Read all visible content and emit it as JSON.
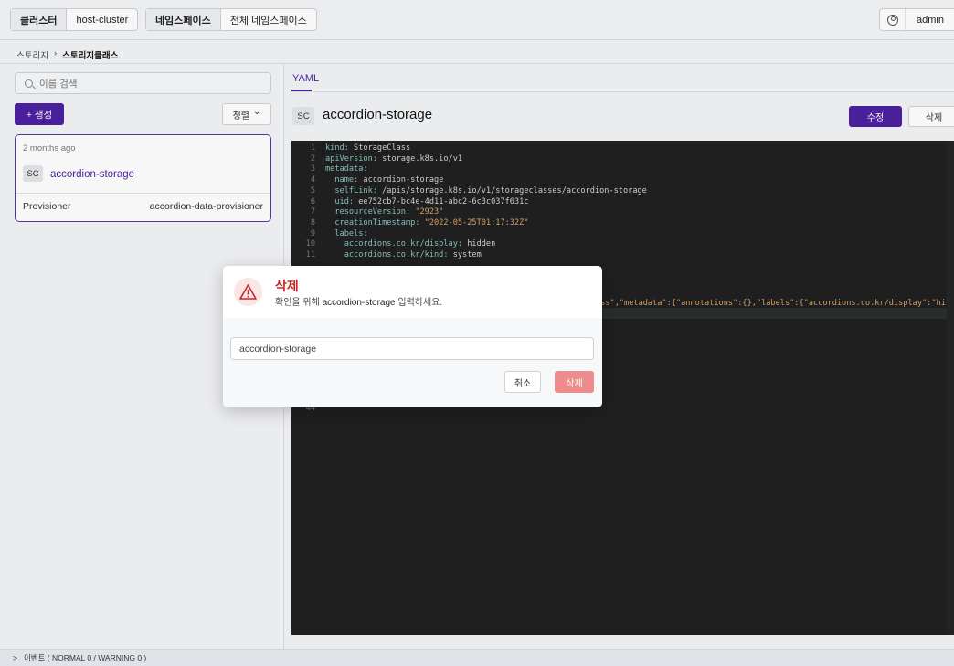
{
  "topbar": {
    "cluster_label": "클러스터",
    "cluster_value": "host-cluster",
    "namespace_label": "네임스페이스",
    "namespace_value": "전체 네임스페이스",
    "user_name": "admin",
    "user_icon": "user-circle-icon"
  },
  "breadcrumb": {
    "parent": "스토리지",
    "separator": "›",
    "current": "스토리지클래스"
  },
  "left": {
    "search_placeholder": "이름 검색",
    "create_label": "+ 생성",
    "sort_label": "정렬",
    "sort_icon": "⌄",
    "card": {
      "age": "2 months ago",
      "badge": "SC",
      "name": "accordion-storage",
      "prop_key": "Provisioner",
      "prop_value": "accordion-data-provisioner"
    }
  },
  "detail": {
    "tab": "YAML",
    "badge": "SC",
    "title": "accordion-storage",
    "edit_label": "수정",
    "delete_label": "삭제"
  },
  "editor": {
    "lines": [
      {
        "n": "1",
        "indent": "",
        "key": "kind",
        "val": "StorageClass"
      },
      {
        "n": "2",
        "indent": "",
        "key": "apiVersion",
        "val": "storage.k8s.io/v1"
      },
      {
        "n": "3",
        "indent": "",
        "key": "metadata",
        "val": ""
      },
      {
        "n": "4",
        "indent": "  ",
        "key": "name",
        "val": "accordion-storage"
      },
      {
        "n": "5",
        "indent": "  ",
        "key": "selfLink",
        "val": "/apis/storage.k8s.io/v1/storageclasses/accordion-storage"
      },
      {
        "n": "6",
        "indent": "  ",
        "key": "uid",
        "val": "ee752cb7-bc4e-4d11-abc2-6c3c037f631c"
      },
      {
        "n": "7",
        "indent": "  ",
        "key": "resourceVersion",
        "val": "\"2923\""
      },
      {
        "n": "8",
        "indent": "  ",
        "key": "creationTimestamp",
        "val": "\"2022-05-25T01:17:32Z\""
      },
      {
        "n": "9",
        "indent": "  ",
        "key": "labels",
        "val": ""
      },
      {
        "n": "10",
        "indent": "    ",
        "key": "accordions.co.kr/display",
        "val": "hidden"
      },
      {
        "n": "11",
        "indent": "    ",
        "key": "accordions.co.kr/kind",
        "val": "system"
      }
    ],
    "partial_line": "ass\",\"metadata\":{\"annotations\":{},\"labels\":{\"accordions.co.kr/display\":\"hi",
    "last_line_no": "44"
  },
  "modal": {
    "title": "삭제",
    "message_prefix": "확인을 위해",
    "message_name": "accordion-storage",
    "message_suffix": "입력하세요.",
    "input_value": "accordion-storage",
    "cancel_label": "취소",
    "confirm_label": "삭제",
    "warning_icon": "warning-triangle-icon",
    "confirm_color": "#ec8c8c",
    "title_color": "#c62828"
  },
  "footer": {
    "chevron": ">",
    "text": "이벤트 ( NORMAL 0 / WARNING 0 )"
  },
  "colors": {
    "accent": "#4b1fa0",
    "editor_bg": "#1f1f1f"
  }
}
